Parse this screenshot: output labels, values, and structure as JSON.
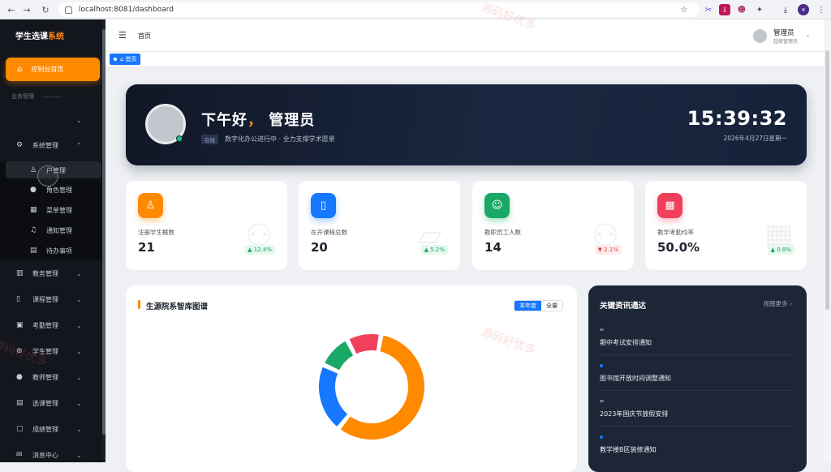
{
  "browser": {
    "url": "localhost:8081/dashboard",
    "profile_initial": "x"
  },
  "sidebar": {
    "title_main": "学生选课",
    "title_accent": "系统",
    "home": "控制台首页",
    "section": "业务管理",
    "system": "系统管理",
    "sub_items": [
      "户管理",
      "角色管理",
      "菜单管理",
      "通知管理",
      "待办事项"
    ],
    "groups": [
      "教务管理",
      "课程管理",
      "考勤管理",
      "学生管理",
      "教师管理",
      "选课管理",
      "成绩管理",
      "消息中心"
    ]
  },
  "topbar": {
    "breadcrumb": "首页",
    "user_name": "管理员",
    "user_role": "超级管理员"
  },
  "tabs": {
    "active": "首页"
  },
  "hero": {
    "greeting": "下午好",
    "comma": "，",
    "name": "管理员",
    "status": "在线",
    "motto": "数字化办公进行中 · 全力支撑学术愿景",
    "time": "15:39:32",
    "date": "2026年4月27日星期一"
  },
  "stats": [
    {
      "label": "注册学生概数",
      "value": "21",
      "trend": "12.4%",
      "direction": "up",
      "color": "#ff8a00",
      "icon": "user-icon"
    },
    {
      "label": "在开课程总数",
      "value": "20",
      "trend": "5.2%",
      "direction": "up",
      "color": "#1677ff",
      "icon": "book-icon"
    },
    {
      "label": "教职员工人数",
      "value": "14",
      "trend": "2.1%",
      "direction": "down",
      "color": "#19a865",
      "icon": "staff-icon"
    },
    {
      "label": "教学考勤均率",
      "value": "50.0%",
      "trend": "0.8%",
      "direction": "up",
      "color": "#f0405a",
      "icon": "calendar-icon"
    }
  ],
  "panel": {
    "title": "生源院系智库图谱",
    "seg_on": "本年度",
    "seg_off": "全量"
  },
  "chart_data": {
    "type": "pie",
    "title": "",
    "slices": [
      {
        "value": 55,
        "color": "#ff8a00"
      },
      {
        "value": 20,
        "color": "#1677ff"
      },
      {
        "value": 10,
        "color": "#19a865"
      },
      {
        "value": 10,
        "color": "#f0405a"
      }
    ]
  },
  "news": {
    "title": "关键资讯通达",
    "more": "视图更多",
    "items": [
      {
        "text": "期中考试安排通知",
        "marker": "gray"
      },
      {
        "text": "图书馆开放时间调整通知",
        "marker": "blue"
      },
      {
        "text": "2023年国庆节放假安排",
        "marker": "gray"
      },
      {
        "text": "教学楼B区装修通知",
        "marker": "blue"
      }
    ]
  },
  "watermark": "源码好优多"
}
